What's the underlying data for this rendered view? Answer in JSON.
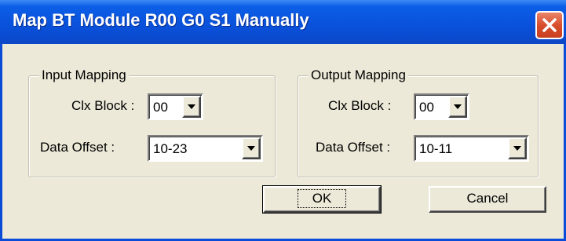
{
  "window": {
    "title": "Map BT Module R00 G0 S1 Manually"
  },
  "input_mapping": {
    "legend": "Input Mapping",
    "clx_block_label": "Clx Block :",
    "clx_block_value": "00",
    "data_offset_label": "Data Offset :",
    "data_offset_value": "10-23"
  },
  "output_mapping": {
    "legend": "Output Mapping",
    "clx_block_label": "Clx Block :",
    "clx_block_value": "00",
    "data_offset_label": "Data Offset :",
    "data_offset_value": "10-11"
  },
  "buttons": {
    "ok_label": "OK",
    "cancel_label": "Cancel"
  },
  "icons": {
    "close": "close-icon",
    "dropdown": "chevron-down-icon"
  },
  "colors": {
    "titlebar": "#0a52dc",
    "close_button": "#d94e2c",
    "dialog_face": "#ece9d8"
  }
}
